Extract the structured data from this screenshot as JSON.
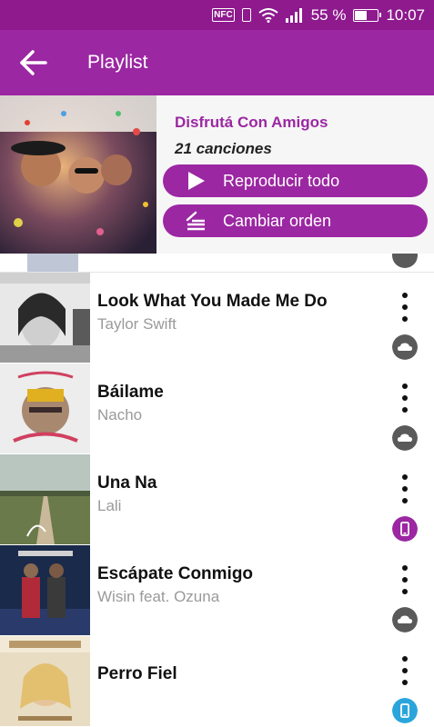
{
  "status_bar": {
    "nfc_label": "NFC",
    "battery_text": "55 %",
    "time": "10:07",
    "battery_level": 0.55
  },
  "app_bar": {
    "title": "Playlist",
    "back_icon": "arrow-left-icon"
  },
  "playlist": {
    "name": "Disfrutá Con Amigos",
    "count": "21 canciones",
    "play_all_label": "Reproducir todo",
    "play_icon": "play-icon",
    "change_order_label": "Cambiar orden",
    "order_icon": "reorder-icon"
  },
  "songs": [
    {
      "title": "Look What You Made Me Do",
      "artist": "Taylor Swift",
      "source": "cloud",
      "source_icon": "cloud-icon"
    },
    {
      "title": "Báilame",
      "artist": "Nacho",
      "source": "cloud",
      "source_icon": "cloud-icon"
    },
    {
      "title": "Una Na",
      "artist": "Lali",
      "source": "device",
      "source_icon": "phone-icon"
    },
    {
      "title": "Escápate Conmigo",
      "artist": "Wisin feat. Ozuna",
      "source": "cloud",
      "source_icon": "cloud-icon"
    },
    {
      "title": "Perro Fiel",
      "artist": "",
      "source": "device-blue",
      "source_icon": "phone-icon"
    }
  ],
  "colors": {
    "status_bar": "#8e1a8e",
    "accent": "#9b27a2",
    "cloud_badge": "#5a5a5a",
    "device_badge_purple": "#9b27a2",
    "device_badge_blue": "#2aa5dc"
  }
}
